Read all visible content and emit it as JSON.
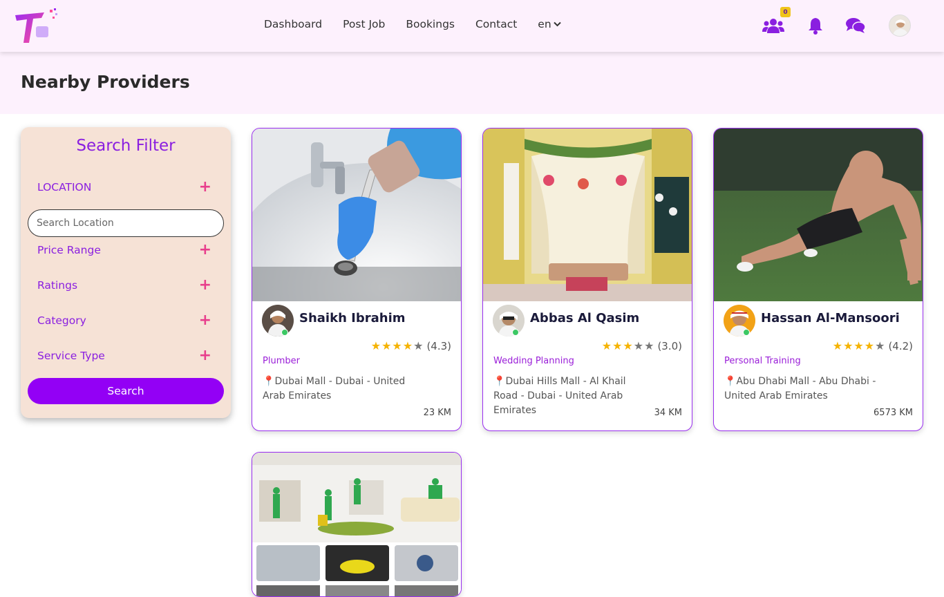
{
  "header": {
    "nav": [
      "Dashboard",
      "Post Job",
      "Bookings",
      "Contact"
    ],
    "language": "en",
    "badge_count": "0",
    "icons": [
      "users-icon",
      "bell-icon",
      "chat-icon"
    ]
  },
  "page": {
    "title": "Nearby Providers"
  },
  "filter": {
    "title": "Search Filter",
    "location_label": "LOCATION",
    "location_placeholder": "Search Location",
    "price_label": "Price Range",
    "ratings_label": "Ratings",
    "category_label": "Category",
    "service_type_label": "Service Type",
    "search_label": "Search"
  },
  "providers": [
    {
      "name": "Shaikh Ibrahim",
      "rating": 4.3,
      "rating_text": "(4.3)",
      "category": "Plumber",
      "address": "Dubai Mall - Dubai - United Arab Emirates",
      "distance": "23 KM"
    },
    {
      "name": "Abbas Al Qasim",
      "rating": 3.0,
      "rating_text": "(3.0)",
      "category": "Wedding Planning",
      "address": "Dubai Hills Mall - Al Khail Road - Dubai - United Arab Emirates",
      "distance": "34 KM"
    },
    {
      "name": "Hassan Al-Mansoori",
      "rating": 4.2,
      "rating_text": "(4.2)",
      "category": "Personal Training",
      "address": "Abu Dhabi Mall - Abu Dhabi - United Arab Emirates",
      "distance": "6573 KM"
    }
  ],
  "colors": {
    "accent": "#9300f5",
    "plus": "#e83e8c",
    "star": "#f5b301",
    "header_bg": "#fdf1fd",
    "filter_bg": "#f6e2d6"
  }
}
